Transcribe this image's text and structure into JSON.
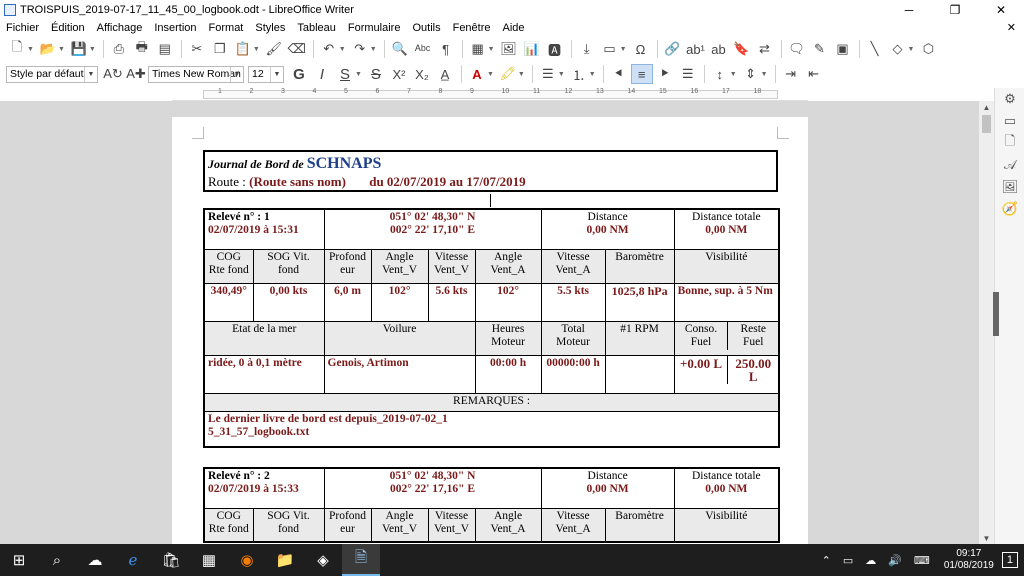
{
  "window": {
    "title": "TROISPUIS_2019-07-17_11_45_00_logbook.odt - LibreOffice Writer",
    "minimize": "─",
    "maximize": "❐",
    "close": "✕"
  },
  "menu": {
    "items": [
      "Fichier",
      "Édition",
      "Affichage",
      "Insertion",
      "Format",
      "Styles",
      "Tableau",
      "Formulaire",
      "Outils",
      "Fenêtre",
      "Aide"
    ],
    "close_doc": "✕"
  },
  "formatting": {
    "paragraph_style": "Style par défaut",
    "font_name": "Times New Roman",
    "font_size": "12"
  },
  "ruler": {
    "numbers": [
      "1",
      "2",
      "3",
      "4",
      "5",
      "6",
      "7",
      "8",
      "9",
      "10",
      "11",
      "12",
      "13",
      "14",
      "15",
      "16",
      "17",
      "18"
    ]
  },
  "document": {
    "header": {
      "journal_prefix": "Journal de Bord de ",
      "boat_name": "SCHNAPS",
      "route_label": "Route : ",
      "route_name": "(Route sans nom)",
      "date_range": "du 02/07/2019  au  17/07/2019"
    },
    "labels": {
      "distance": "Distance",
      "distance_total": "Distance totale",
      "cog": "COG Rte fond",
      "sog": "SOG Vit. fond",
      "depth": "Profond eur",
      "angle_vent_v": "Angle Vent_V",
      "vitesse_vent_v": "Vitesse Vent_V",
      "angle_vent_a": "Angle Vent_A",
      "vitesse_vent_a": "Vitesse Vent_A",
      "barometer": "Baromètre",
      "visibility": "Visibilité",
      "sea_state": "Etat de la mer",
      "sails": "Voilure",
      "engine_hours": "Heures Moteur",
      "engine_total": "Total Moteur",
      "rpm": "#1 RPM",
      "fuel_consumption": "Conso. Fuel",
      "fuel_remaining": "Reste Fuel",
      "remarks": "REMARQUES :"
    },
    "entries": [
      {
        "releve": "Relevé n° : 1",
        "datetime": "02/07/2019  à  15:31",
        "lat": "051° 02' 48,30\" N",
        "lon": "002° 22' 17,10\" E",
        "distance": "0,00 NM",
        "distance_total": "0,00 NM",
        "cog": "340,49°",
        "sog": "0,00 kts",
        "depth": "6,0 m",
        "angle_vent_v": "102°",
        "vitesse_vent_v": "5.6 kts",
        "angle_vent_a": "102°",
        "vitesse_vent_a": "5.5 kts",
        "barometer": "1025,8 hPa",
        "visibility": "Bonne, sup. à 5 Nm",
        "sea_state": "ridée, 0 à 0,1 mètre",
        "sails": "Genois, Artimon",
        "engine_hours": "00:00 h",
        "engine_total": "00000:00 h",
        "rpm": "",
        "fuel_consumption": "+0.00 L",
        "fuel_remaining": "250.00 L",
        "remarks": "Le dernier livre de bord est depuis_2019-07-02_15_31_57_logbook.txt"
      },
      {
        "releve": "Relevé n° : 2",
        "datetime": "02/07/2019  à  15:33",
        "lat": "051° 02' 48,30\" N",
        "lon": "002° 22' 17,16\" E",
        "distance": "0,00 NM",
        "distance_total": "0,00 NM"
      }
    ]
  },
  "taskbar": {
    "time": "09:17",
    "date": "01/08/2019",
    "notification_count": "1"
  }
}
